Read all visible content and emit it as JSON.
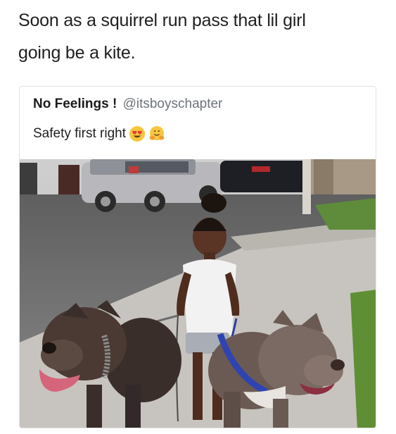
{
  "post": {
    "caption_line1": "Soon as a squirrel run pass that lil girl",
    "caption_line2": "going be a kite."
  },
  "tweet": {
    "display_name": "No Feelings !",
    "handle": "@itsboyschapter",
    "text": "Safety first right",
    "emojis": [
      "heart-eyes-emoji",
      "hugging-face-emoji"
    ]
  },
  "colors": {
    "text": "#1f1f1f",
    "handle": "#6e7379",
    "card_border": "#e3e3e3"
  }
}
